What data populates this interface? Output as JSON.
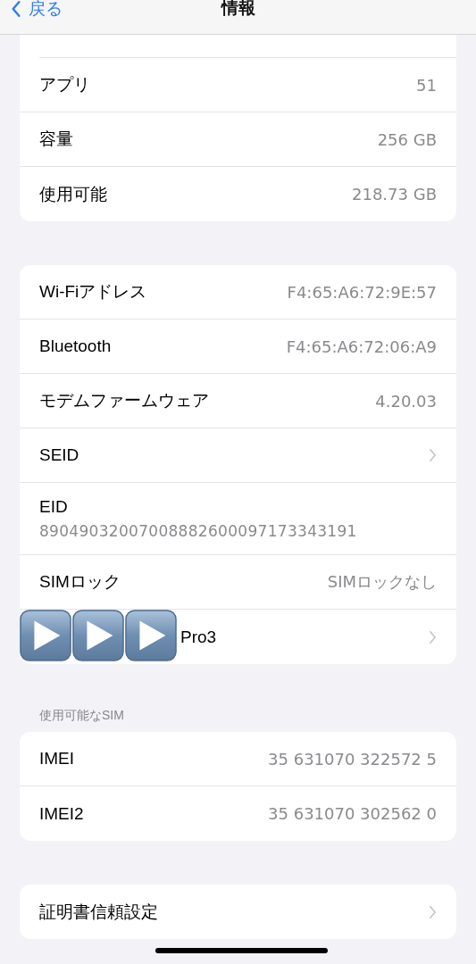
{
  "nav": {
    "back": "戻る",
    "title": "情報"
  },
  "groups": [
    {
      "rows": [
        {
          "kind": "value",
          "label": "アプリ",
          "value": "51"
        },
        {
          "kind": "value",
          "label": "容量",
          "value": "256 GB"
        },
        {
          "kind": "value",
          "label": "使用可能",
          "value": "218.73 GB"
        }
      ]
    },
    {
      "rows": [
        {
          "kind": "value",
          "label": "Wi-Fiアドレス",
          "value": "F4:65:A6:72:9E:57"
        },
        {
          "kind": "value",
          "label": "Bluetooth",
          "value": "F4:65:A6:72:06:A9"
        },
        {
          "kind": "value",
          "label": "モデムファームウェア",
          "value": "4.20.03"
        },
        {
          "kind": "link",
          "label": "SEID"
        },
        {
          "kind": "stacked",
          "label": "EID",
          "value": "89049032007008882600097173343191"
        },
        {
          "kind": "value",
          "label": "SIMロック",
          "value": "SIMロックなし"
        },
        {
          "kind": "link",
          "label": "Pro3",
          "covered": true
        }
      ]
    },
    {
      "header": "使用可能なSIM",
      "rows": [
        {
          "kind": "value",
          "label": "IMEI",
          "value": "35 631070 322572 5"
        },
        {
          "kind": "value",
          "label": "IMEI2",
          "value": "35 631070 302562 0"
        }
      ]
    },
    {
      "rows": [
        {
          "kind": "link",
          "label": "証明書信頼設定"
        }
      ]
    }
  ]
}
